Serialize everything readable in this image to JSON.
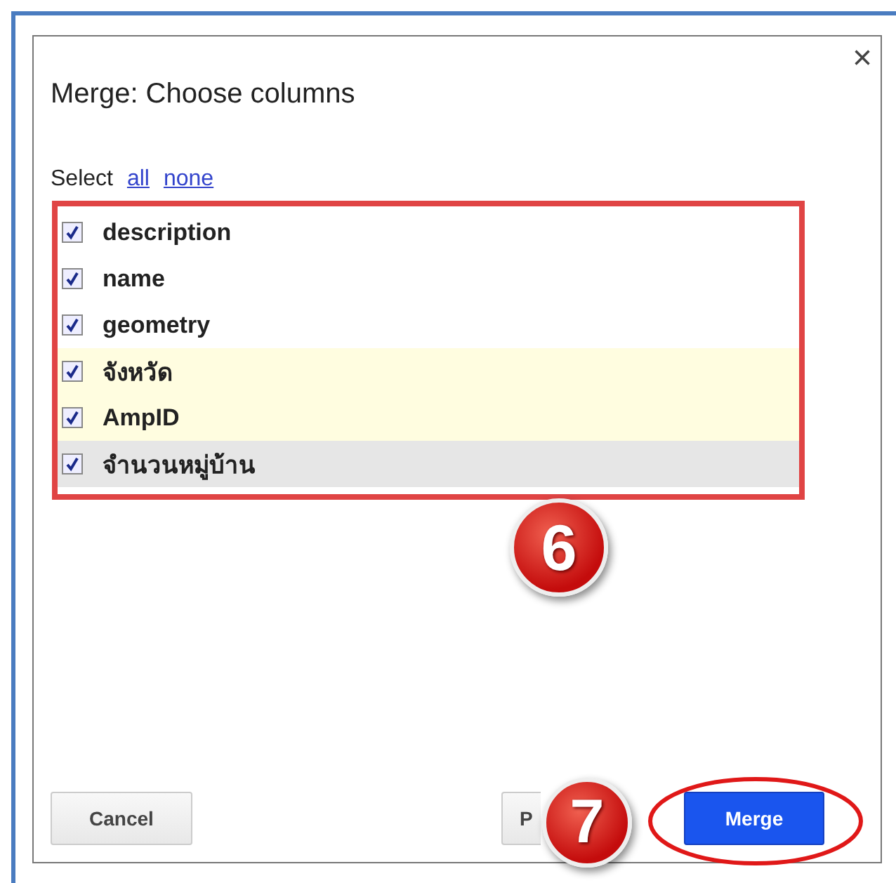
{
  "dialog": {
    "title": "Merge: Choose columns",
    "close": "×"
  },
  "select": {
    "label": "Select",
    "links": [
      "all",
      "none"
    ]
  },
  "columns": [
    {
      "name": "description",
      "checked": true,
      "color": "#ffffff"
    },
    {
      "name": "name",
      "checked": true,
      "color": "#ffffff"
    },
    {
      "name": "geometry",
      "checked": true,
      "color": "#ffffff"
    },
    {
      "name": "จังหวัด",
      "checked": true,
      "color": "#fffde0"
    },
    {
      "name": "AmpID",
      "checked": true,
      "color": "#fffde0"
    },
    {
      "name": "จำนวนหมู่บ้าน",
      "checked": true,
      "color": "#e6e6e6"
    }
  ],
  "buttons": [
    {
      "label": "Cancel",
      "kind": "plain"
    },
    {
      "label": "P",
      "kind": "plain"
    },
    {
      "label": "Merge",
      "kind": "primary"
    }
  ],
  "annotations": [
    {
      "label": "6"
    },
    {
      "label": "7"
    }
  ]
}
